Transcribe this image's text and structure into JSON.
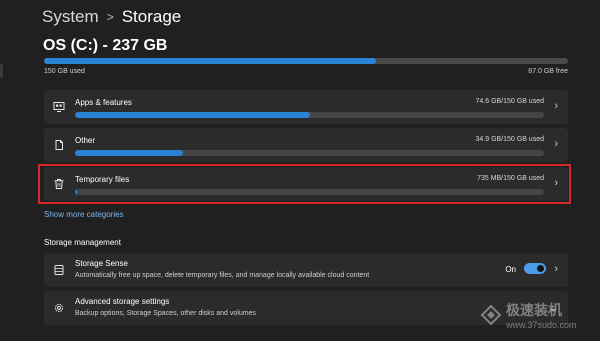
{
  "breadcrumb": {
    "parent": "System",
    "separator": ">",
    "current": "Storage"
  },
  "drive": {
    "title": "OS (C:) - 237 GB",
    "used_label": "150 GB used",
    "free_label": "87.0 GB free",
    "used_fraction": 0.633
  },
  "categories": [
    {
      "label": "Apps & features",
      "size": "74.6 GB/150 GB used",
      "fraction": 0.5,
      "icon": "apps-icon"
    },
    {
      "label": "Other",
      "size": "34.9 GB/150 GB used",
      "fraction": 0.23,
      "icon": "document-icon"
    },
    {
      "label": "Temporary files",
      "size": "735 MB/150 GB used",
      "fraction": 0.005,
      "icon": "trash-icon"
    }
  ],
  "show_more": "Show more categories",
  "storage_management": {
    "title": "Storage management",
    "storage_sense": {
      "title": "Storage Sense",
      "subtitle": "Automatically free up space, delete temporary files, and manage locally available cloud content",
      "toggle_label": "On",
      "toggle_on": true
    },
    "advanced": {
      "title": "Advanced storage settings",
      "subtitle": "Backup options, Storage Spaces, other disks and volumes"
    }
  },
  "colors": {
    "accent": "#2a83d6",
    "highlight": "#d9262d",
    "background": "#202020",
    "card": "#2b2b2b"
  },
  "watermark": {
    "text": "极速装机",
    "url": "www.37sudo.com"
  }
}
